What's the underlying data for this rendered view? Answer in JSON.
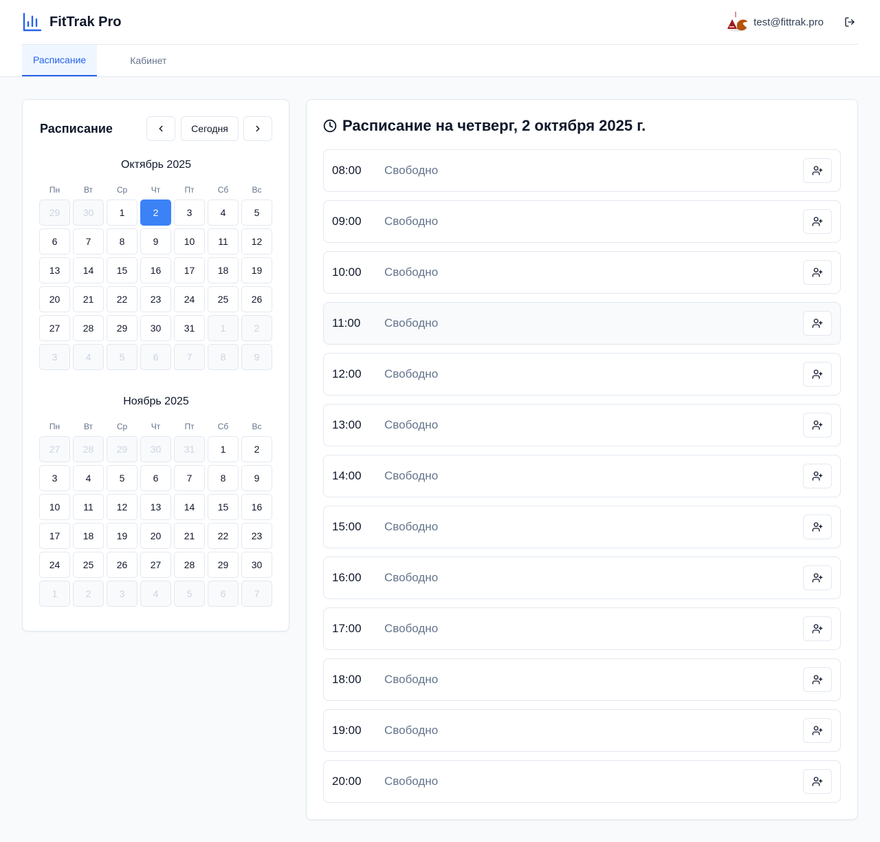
{
  "app": {
    "title": "FitTrak Pro"
  },
  "user": {
    "email": "test@fittrak.pro"
  },
  "tabs": [
    {
      "label": "Расписание",
      "active": true
    },
    {
      "label": "Кабинет",
      "active": false
    }
  ],
  "calendar": {
    "title": "Расписание",
    "today_label": "Сегодня",
    "weekdays": [
      "Пн",
      "Вт",
      "Ср",
      "Чт",
      "Пт",
      "Сб",
      "Вс"
    ],
    "months": [
      {
        "name": "Октябрь 2025",
        "days": [
          {
            "d": "29",
            "out": true
          },
          {
            "d": "30",
            "out": true
          },
          {
            "d": "1"
          },
          {
            "d": "2",
            "selected": true
          },
          {
            "d": "3"
          },
          {
            "d": "4"
          },
          {
            "d": "5"
          },
          {
            "d": "6"
          },
          {
            "d": "7"
          },
          {
            "d": "8"
          },
          {
            "d": "9"
          },
          {
            "d": "10"
          },
          {
            "d": "11"
          },
          {
            "d": "12"
          },
          {
            "d": "13"
          },
          {
            "d": "14"
          },
          {
            "d": "15"
          },
          {
            "d": "16"
          },
          {
            "d": "17"
          },
          {
            "d": "18"
          },
          {
            "d": "19"
          },
          {
            "d": "20"
          },
          {
            "d": "21"
          },
          {
            "d": "22"
          },
          {
            "d": "23"
          },
          {
            "d": "24"
          },
          {
            "d": "25"
          },
          {
            "d": "26"
          },
          {
            "d": "27"
          },
          {
            "d": "28"
          },
          {
            "d": "29"
          },
          {
            "d": "30"
          },
          {
            "d": "31"
          },
          {
            "d": "1",
            "out": true
          },
          {
            "d": "2",
            "out": true
          },
          {
            "d": "3",
            "out": true
          },
          {
            "d": "4",
            "out": true
          },
          {
            "d": "5",
            "out": true
          },
          {
            "d": "6",
            "out": true
          },
          {
            "d": "7",
            "out": true
          },
          {
            "d": "8",
            "out": true
          },
          {
            "d": "9",
            "out": true
          }
        ]
      },
      {
        "name": "Ноябрь 2025",
        "days": [
          {
            "d": "27",
            "out": true
          },
          {
            "d": "28",
            "out": true
          },
          {
            "d": "29",
            "out": true
          },
          {
            "d": "30",
            "out": true
          },
          {
            "d": "31",
            "out": true
          },
          {
            "d": "1"
          },
          {
            "d": "2"
          },
          {
            "d": "3"
          },
          {
            "d": "4"
          },
          {
            "d": "5"
          },
          {
            "d": "6"
          },
          {
            "d": "7"
          },
          {
            "d": "8"
          },
          {
            "d": "9"
          },
          {
            "d": "10"
          },
          {
            "d": "11"
          },
          {
            "d": "12"
          },
          {
            "d": "13"
          },
          {
            "d": "14"
          },
          {
            "d": "15"
          },
          {
            "d": "16"
          },
          {
            "d": "17"
          },
          {
            "d": "18"
          },
          {
            "d": "19"
          },
          {
            "d": "20"
          },
          {
            "d": "21"
          },
          {
            "d": "22"
          },
          {
            "d": "23"
          },
          {
            "d": "24"
          },
          {
            "d": "25"
          },
          {
            "d": "26"
          },
          {
            "d": "27"
          },
          {
            "d": "28"
          },
          {
            "d": "29"
          },
          {
            "d": "30"
          },
          {
            "d": "1",
            "out": true
          },
          {
            "d": "2",
            "out": true
          },
          {
            "d": "3",
            "out": true
          },
          {
            "d": "4",
            "out": true
          },
          {
            "d": "5",
            "out": true
          },
          {
            "d": "6",
            "out": true
          },
          {
            "d": "7",
            "out": true
          }
        ]
      }
    ]
  },
  "schedule": {
    "title": "Расписание на четверг, 2 октября 2025 г.",
    "slots": [
      {
        "time": "08:00",
        "status": "Свободно"
      },
      {
        "time": "09:00",
        "status": "Свободно"
      },
      {
        "time": "10:00",
        "status": "Свободно"
      },
      {
        "time": "11:00",
        "status": "Свободно",
        "hover": true
      },
      {
        "time": "12:00",
        "status": "Свободно"
      },
      {
        "time": "13:00",
        "status": "Свободно"
      },
      {
        "time": "14:00",
        "status": "Свободно"
      },
      {
        "time": "15:00",
        "status": "Свободно"
      },
      {
        "time": "16:00",
        "status": "Свободно"
      },
      {
        "time": "17:00",
        "status": "Свободно"
      },
      {
        "time": "18:00",
        "status": "Свободно"
      },
      {
        "time": "19:00",
        "status": "Свободно"
      },
      {
        "time": "20:00",
        "status": "Свободно"
      }
    ]
  },
  "colors": {
    "accent": "#3b82f6",
    "accent_text": "#2563eb",
    "muted": "#64748b",
    "border": "#e2e8f0",
    "background": "#f8fafc"
  },
  "icons": {
    "brand": "bar-chart-icon",
    "logout": "logout-icon",
    "prev": "chevron-left-icon",
    "next": "chevron-right-icon",
    "clock": "clock-icon",
    "add_client": "user-plus-icon"
  }
}
